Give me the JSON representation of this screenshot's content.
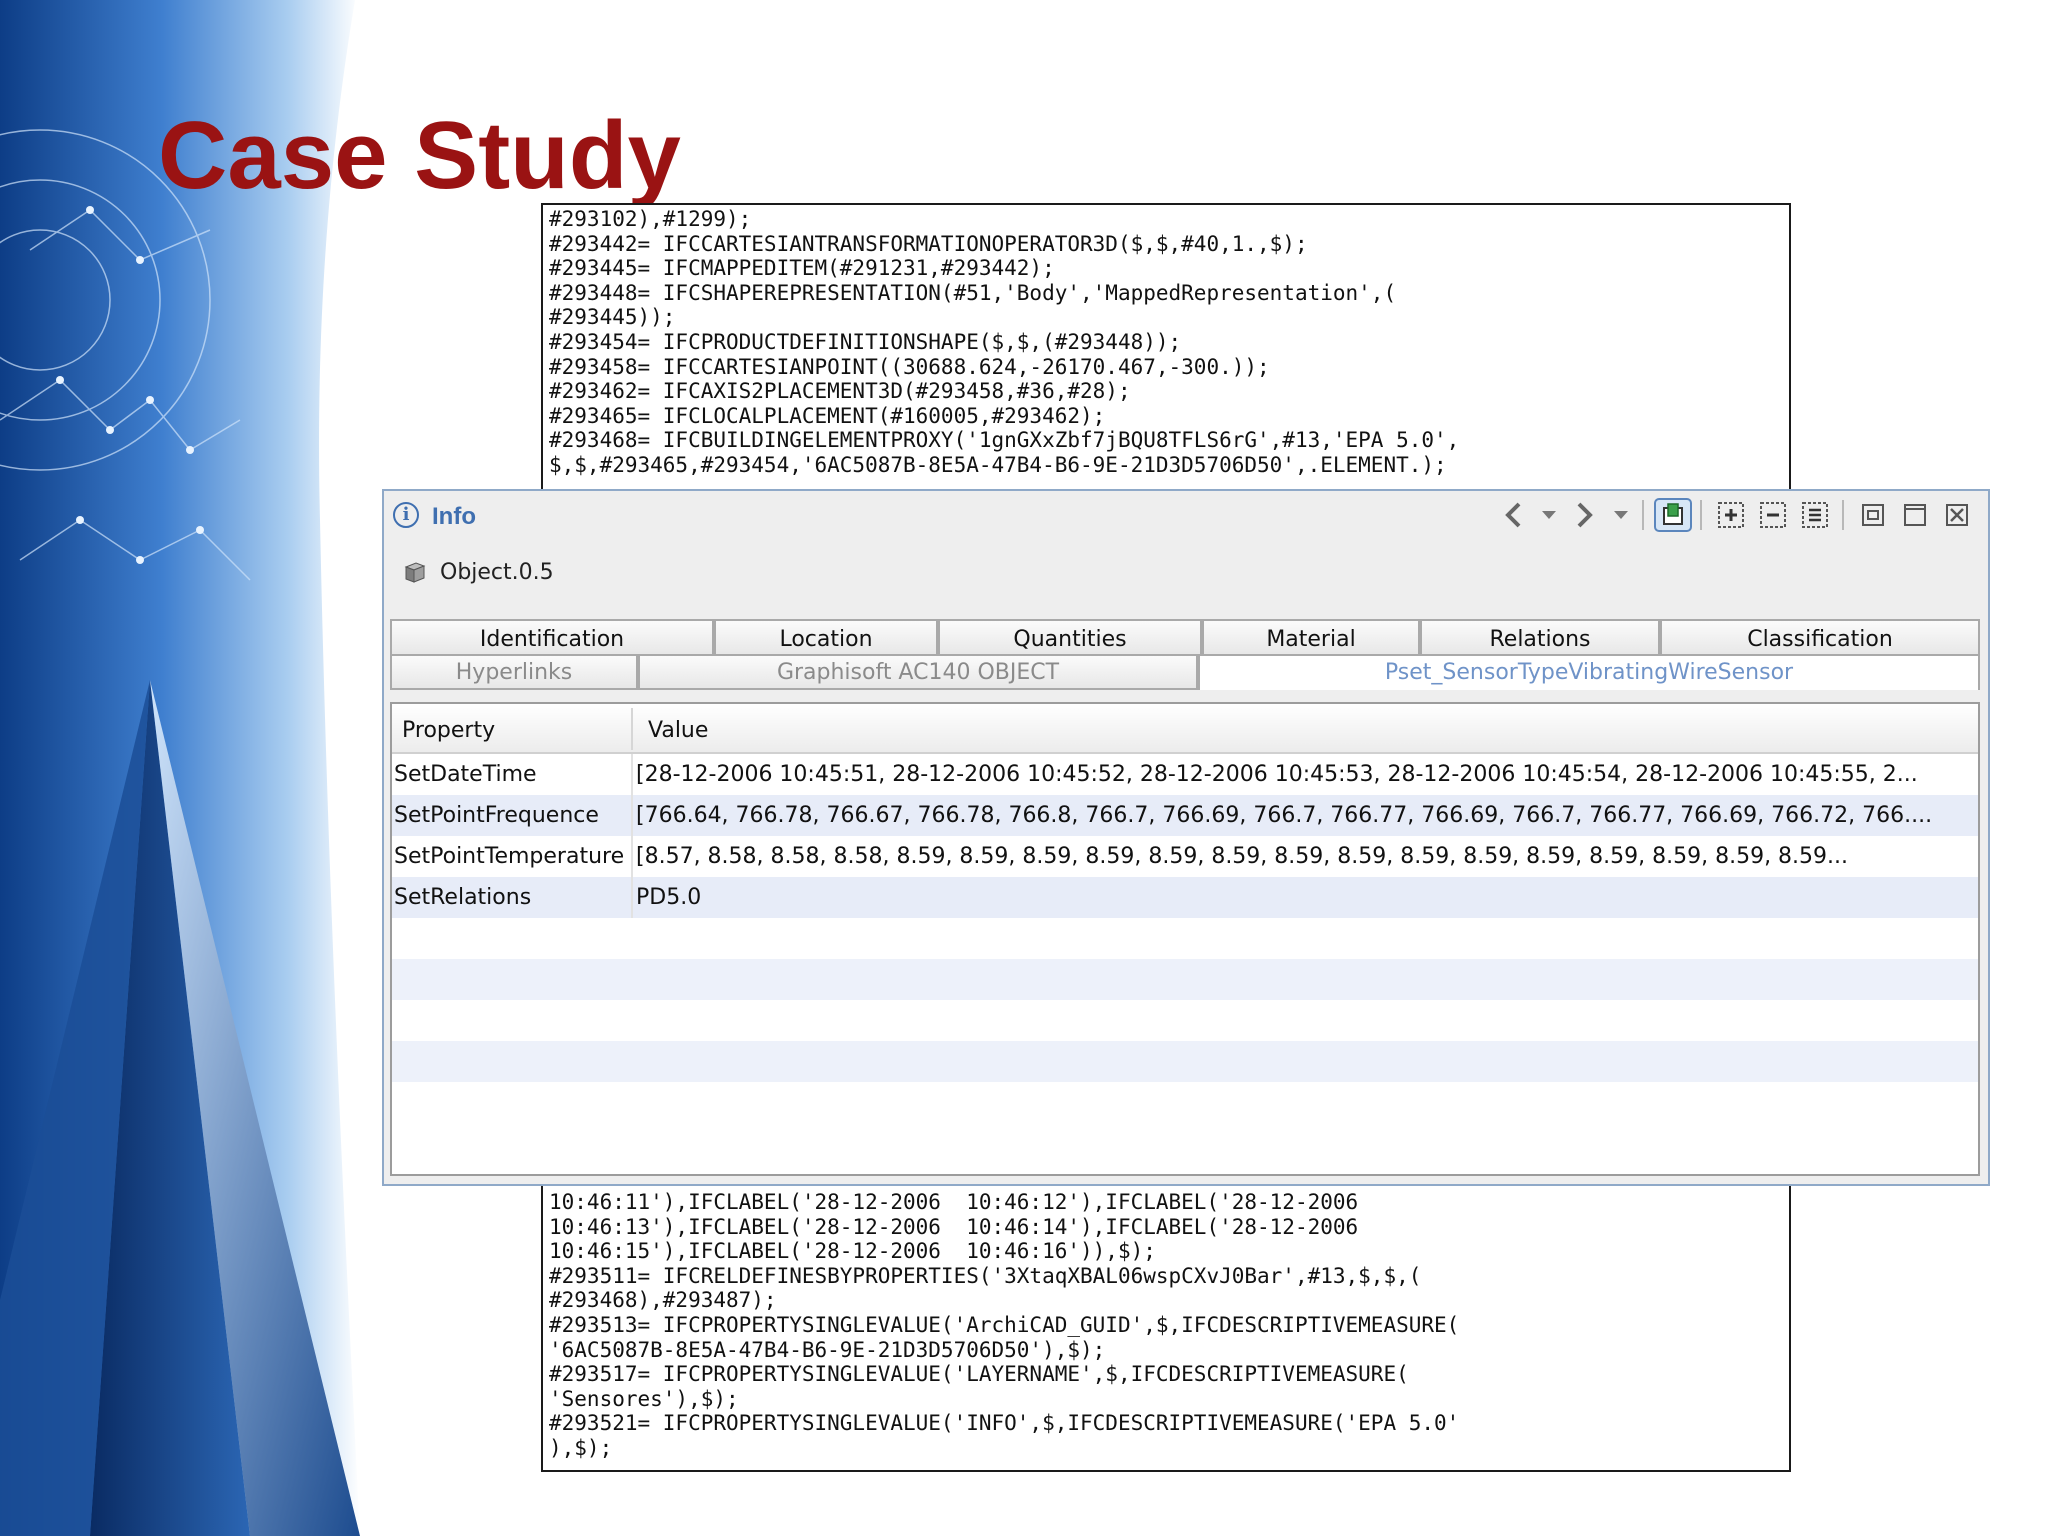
{
  "slide": {
    "title": "Case Study"
  },
  "code_top": "#293102),#1299);\n#293442= IFCCARTESIANTRANSFORMATIONOPERATOR3D($,$,#40,1.,$);\n#293445= IFCMAPPEDITEM(#291231,#293442);\n#293448= IFCSHAPEREPRESENTATION(#51,'Body','MappedRepresentation',(\n#293445));\n#293454= IFCPRODUCTDEFINITIONSHAPE($,$,(#293448));\n#293458= IFCCARTESIANPOINT((30688.624,-26170.467,-300.));\n#293462= IFCAXIS2PLACEMENT3D(#293458,#36,#28);\n#293465= IFCLOCALPLACEMENT(#160005,#293462);\n#293468= IFCBUILDINGELEMENTPROXY('1gnGXxZbf7jBQU8TFLS6rG',#13,'EPA 5.0',\n$,$,#293465,#293454,'6AC5087B-8E5A-47B4-B6-9E-21D3D5706D50',.ELEMENT.);",
  "code_bottom": "10:46:11'),IFCLABEL('28-12-2006  10:46:12'),IFCLABEL('28-12-2006\n10:46:13'),IFCLABEL('28-12-2006  10:46:14'),IFCLABEL('28-12-2006\n10:46:15'),IFCLABEL('28-12-2006  10:46:16')),$);\n#293511= IFCRELDEFINESBYPROPERTIES('3XtaqXBAL06wspCXvJ0Bar',#13,$,$,(\n#293468),#293487);\n#293513= IFCPROPERTYSINGLEVALUE('ArchiCAD_GUID',$,IFCDESCRIPTIVEMEASURE(\n'6AC5087B-8E5A-47B4-B6-9E-21D3D5706D50'),$);\n#293517= IFCPROPERTYSINGLEVALUE('LAYERNAME',$,IFCDESCRIPTIVEMEASURE(\n'Sensores'),$);\n#293521= IFCPROPERTYSINGLEVALUE('INFO',$,IFCDESCRIPTIVEMEASURE('EPA 5.0'\n),$);",
  "info": {
    "title": "Info",
    "object_name": "Object.0.5",
    "icons": [
      "info-icon",
      "back-arrow-icon",
      "dropdown-icon",
      "forward-arrow-icon",
      "dropdown-icon",
      "pin-icon",
      "expand-all-icon",
      "collapse-all-icon",
      "list-icon",
      "restore-icon",
      "maximize-icon",
      "close-icon",
      "cube-icon"
    ],
    "accent": "#3f6fb0",
    "tabs_row1": [
      "Identification",
      "Location",
      "Quantities",
      "Material",
      "Relations",
      "Classification"
    ],
    "tabs_row2": [
      "Hyperlinks",
      "Graphisoft AC140 OBJECT",
      "Pset_SensorTypeVibratingWireSensor"
    ],
    "active_tab": "Pset_SensorTypeVibratingWireSensor",
    "grid": {
      "headers": [
        "Property",
        "Value"
      ],
      "rows": [
        {
          "property": "SetDateTime",
          "value": "[28-12-2006  10:45:51, 28-12-2006  10:45:52, 28-12-2006  10:45:53, 28-12-2006  10:45:54, 28-12-2006  10:45:55, 2..."
        },
        {
          "property": "SetPointFrequence",
          "value": "[766.64, 766.78, 766.67, 766.78, 766.8, 766.7, 766.69, 766.7, 766.77, 766.69, 766.7, 766.77, 766.69, 766.72, 766...."
        },
        {
          "property": "SetPointTemperature",
          "value": "[8.57, 8.58, 8.58, 8.58, 8.59, 8.59, 8.59, 8.59, 8.59, 8.59, 8.59, 8.59, 8.59, 8.59, 8.59, 8.59, 8.59, 8.59, 8.59..."
        },
        {
          "property": "SetRelations",
          "value": "PD5.0"
        }
      ]
    }
  }
}
